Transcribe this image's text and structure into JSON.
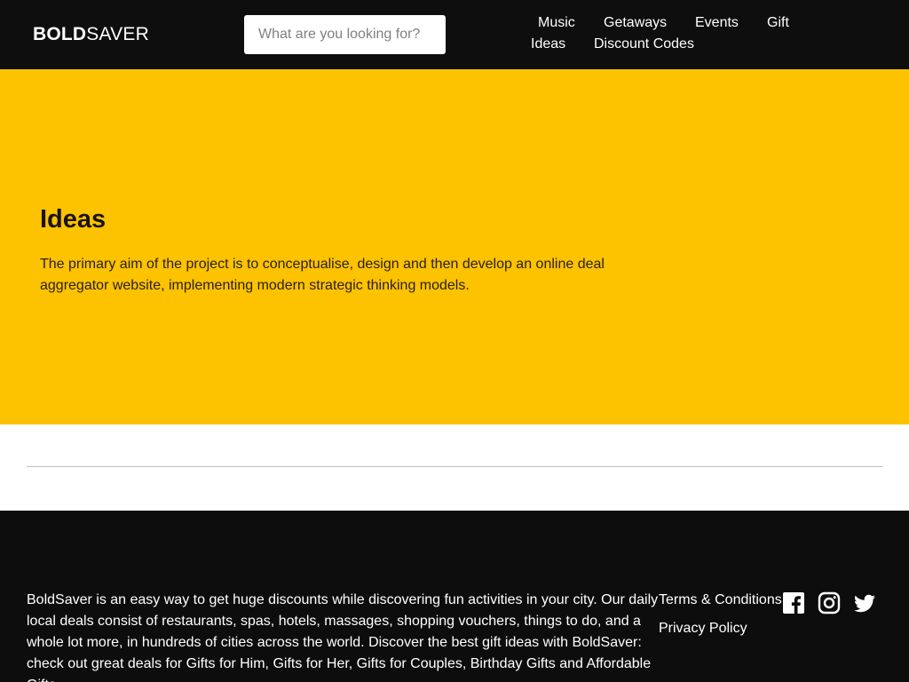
{
  "header": {
    "logo_bold": "BOLD",
    "logo_light": "SAVER",
    "search_placeholder": "What are you looking for?",
    "nav": {
      "music": "Music",
      "getaways": "Getaways",
      "events": "Events",
      "gift": "Gift",
      "ideas": "Ideas",
      "discount_codes": "Discount Codes"
    }
  },
  "hero": {
    "title": "Ideas",
    "description": "The primary aim of the project is to conceptualise, design and then develop an online deal aggregator website, implementing modern strategic thinking models."
  },
  "footer": {
    "about": "BoldSaver is an easy way to get huge discounts while discovering fun activities in your city. Our daily local deals consist of restaurants, spas, hotels, massages, shopping vouchers, things to do, and a whole lot more, in hundreds of cities across the world. Discover the best gift ideas with BoldSaver: check out great deals for Gifts for Him, Gifts for Her, Gifts for Couples, Birthday Gifts and Affordable Gifts.",
    "links": {
      "terms": "Terms & Conditions",
      "privacy": "Privacy Policy"
    },
    "social_icons": [
      "facebook-icon",
      "instagram-icon",
      "twitter-icon"
    ]
  },
  "colors": {
    "header_bg": "#0f0e0f",
    "hero_bg": "#fdc200",
    "footer_bg": "#0d0d0d",
    "text_light": "#ffffff"
  }
}
